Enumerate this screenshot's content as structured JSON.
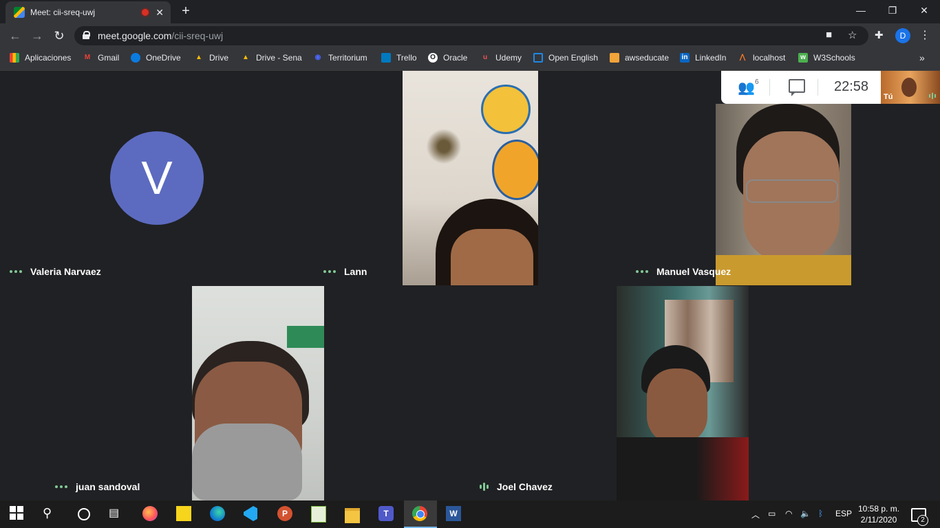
{
  "browser": {
    "tab_title": "Meet: cii-sreq-uwj",
    "url_host": "meet.google.com",
    "url_path": "/cii-sreq-uwj",
    "profile_initial": "D"
  },
  "bookmarks": [
    {
      "label": "Aplicaciones",
      "icon": "apps-grid-icon",
      "color": "#ea4335"
    },
    {
      "label": "Gmail",
      "icon": "gmail-icon",
      "color": "#ea4335"
    },
    {
      "label": "OneDrive",
      "icon": "onedrive-icon",
      "color": "#0a7ce0"
    },
    {
      "label": "Drive",
      "icon": "google-drive-icon",
      "color": "#0f9d58"
    },
    {
      "label": "Drive - Sena",
      "icon": "google-drive-icon",
      "color": "#0f9d58"
    },
    {
      "label": "Territorium",
      "icon": "territorium-icon",
      "color": "#4a67ff"
    },
    {
      "label": "Trello",
      "icon": "trello-icon",
      "color": "#0079bf"
    },
    {
      "label": "Oracle",
      "icon": "oracle-icon",
      "color": "#ffffff"
    },
    {
      "label": "Udemy",
      "icon": "udemy-icon",
      "color": "#ec5252"
    },
    {
      "label": "Open English",
      "icon": "open-english-icon",
      "color": "#1e88e5"
    },
    {
      "label": "awseducate",
      "icon": "aws-icon",
      "color": "#f2a33a"
    },
    {
      "label": "LinkedIn",
      "icon": "linkedin-icon",
      "color": "#0a66c2"
    },
    {
      "label": "localhost",
      "icon": "xampp-icon",
      "color": "#fb7a24"
    },
    {
      "label": "W3Schools",
      "icon": "w3schools-icon",
      "color": "#4caf50"
    }
  ],
  "meet": {
    "participant_count": "6",
    "time": "22:58",
    "self_label": "Tú",
    "participants": [
      {
        "name": "Valeria Narvaez",
        "initial": "V",
        "video": false,
        "speaking": false
      },
      {
        "name": "Lann",
        "video": true,
        "speaking": false
      },
      {
        "name": "Manuel Vasquez",
        "video": true,
        "speaking": false
      },
      {
        "name": "juan sandoval",
        "video": true,
        "speaking": false
      },
      {
        "name": "Joel Chavez",
        "video": true,
        "speaking": true
      }
    ]
  },
  "taskbar": {
    "language": "ESP",
    "time": "10:58 p. m.",
    "date": "2/11/2020",
    "notification_count": "2",
    "apps": [
      "firefox",
      "sticky-notes",
      "edge",
      "vscode",
      "powerpoint",
      "notepad-plus-plus",
      "file-explorer",
      "teams",
      "chrome",
      "word"
    ]
  },
  "colors": {
    "meet_background": "#202124",
    "avatar_color": "#5c6bc0",
    "audio_indicator": "#81c995",
    "accent": "#1a73e8"
  }
}
